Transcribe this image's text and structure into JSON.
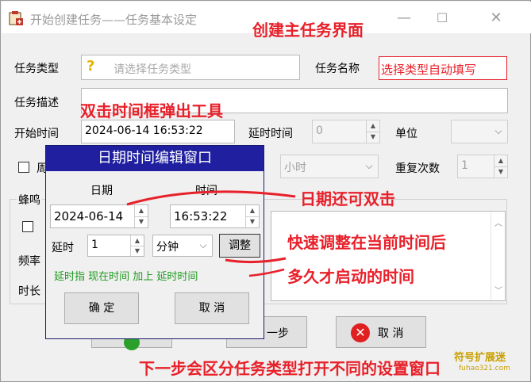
{
  "window": {
    "title": "开始创建任务——任务基本设定",
    "minimize_glyph": "—",
    "maximize_glyph": "☐",
    "close_glyph": "✕"
  },
  "form": {
    "task_type_label": "任务类型",
    "task_type_placeholder": "请选择任务类型",
    "task_type_icon_glyph": "?",
    "task_name_label": "任务名称",
    "task_name_value": "选择类型自动填写",
    "task_desc_label": "任务描述",
    "task_desc_value": "",
    "start_time_label": "开始时间",
    "start_time_value": "2024-06-14 16:53:22",
    "delay_time_label": "延时时间",
    "delay_time_value": "0",
    "unit_label": "单位",
    "unit_value": "",
    "cycle_check_label": "周",
    "cycle_unit_value": "小时",
    "repeat_label": "重复次数",
    "repeat_value": "1",
    "buzzer_group_label": "蜂鸣",
    "freq_label": "频率",
    "duration_label": "时长",
    "next_button_label": "一步",
    "cancel_button_label": "取 消"
  },
  "popup": {
    "title": "日期时间编辑窗口",
    "date_label": "日期",
    "time_label": "时间",
    "date_value": "2024-06-14",
    "time_value": "16:53:22",
    "delay_label": "延时",
    "delay_value": "1",
    "delay_unit_value": "分钟",
    "adjust_button_label": "调整",
    "hint_text": "延时指 现在时间 加上 延时时间",
    "ok_button_label": "确 定",
    "cancel_button_label": "取 消"
  },
  "annotations": {
    "main_ui": "创建主任务界面",
    "dbl_click_time": "双击时间框弹出工具",
    "date_dbl_click": "日期还可双击",
    "quick_adjust_1": "快速调整在当前时间后",
    "quick_adjust_2": "多久才启动的时间",
    "next_step": "下一步会区分任务类型打开不同的设置窗口"
  },
  "watermark": {
    "line1": "符号扩展迷",
    "line2": "fuhao321.com"
  },
  "colors": {
    "annotation_red": "#e8202a",
    "popup_title_blue": "#1f1fa0",
    "hint_green": "#1f9a1f"
  }
}
